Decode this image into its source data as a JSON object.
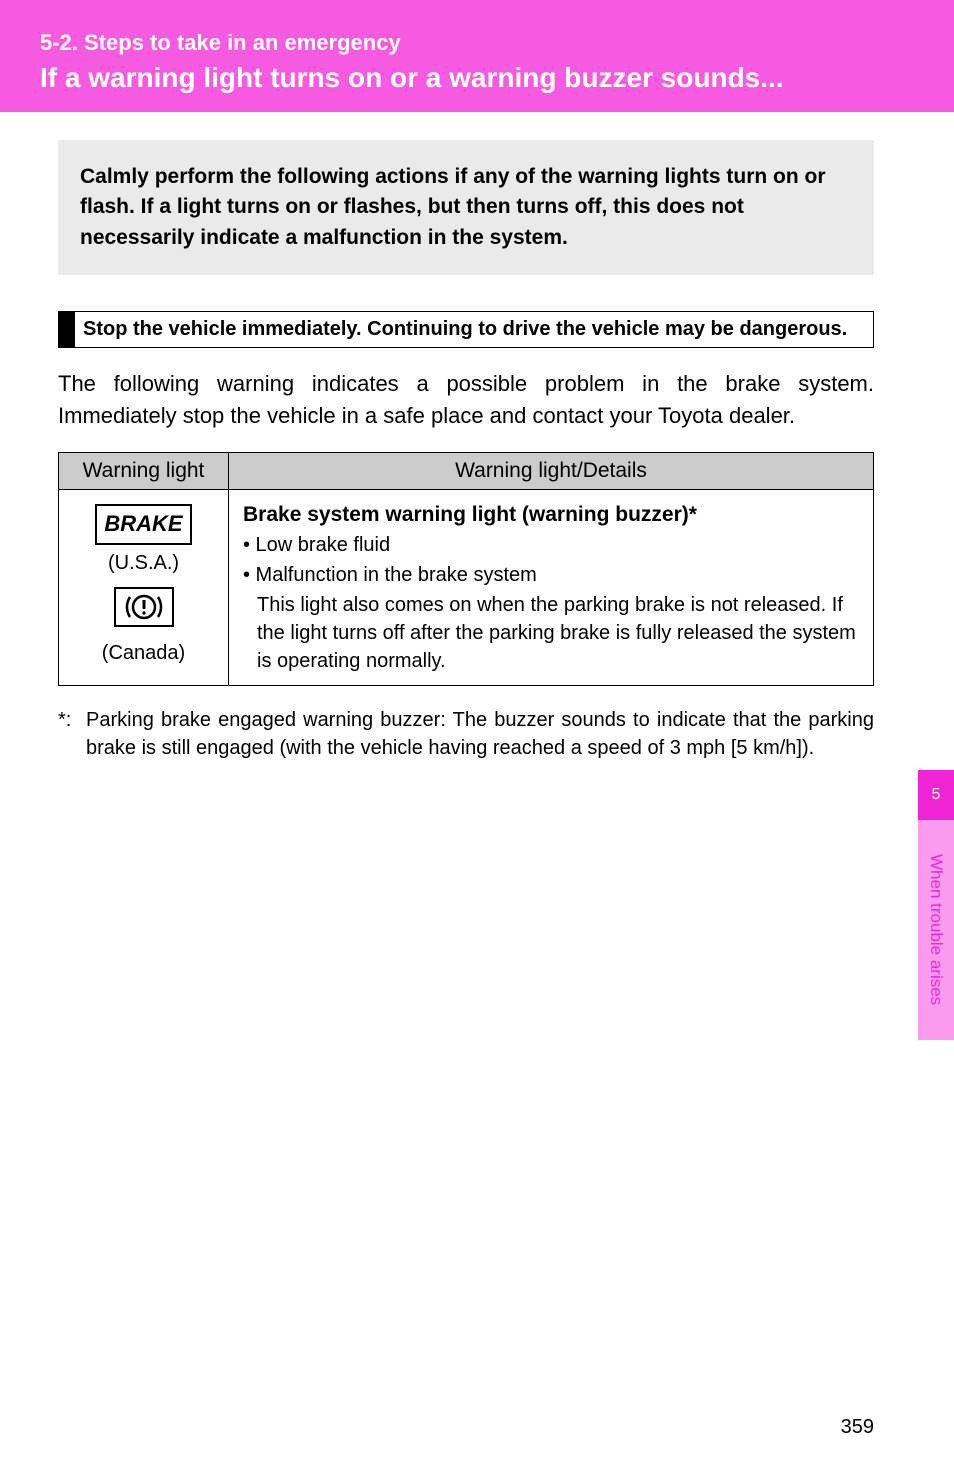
{
  "header": {
    "section_number": "5-2. Steps to take in an emergency",
    "title": "If a warning light turns on or a warning buzzer sounds..."
  },
  "intro": "Calmly perform the following actions if any of the warning lights turn on or flash. If a light turns on or flashes, but then turns off, this does not necessarily indicate a malfunction in the system.",
  "subhead": "Stop the vehicle immediately. Continuing to drive the vehicle may be dangerous.",
  "body": "The following warning indicates a possible problem in the brake system. Immediately stop the vehicle in a safe place and contact your Toyota dealer.",
  "table": {
    "col1_header": "Warning light",
    "col2_header": "Warning light/Details",
    "row1": {
      "icon_brake": "BRAKE",
      "label_usa": "(U.S.A.)",
      "label_canada": "(Canada)",
      "details_title": "Brake system warning light (warning buzzer)*",
      "bullet1": "• Low brake fluid",
      "bullet2": "• Malfunction in the brake system",
      "indent_text": "This light also comes on when the parking brake is not released. If the light turns off after the parking brake is fully released the system is operating normally."
    }
  },
  "footnote": {
    "marker": "*:",
    "text": "Parking brake engaged warning buzzer: The buzzer sounds to indicate that the parking brake is still engaged (with the vehicle having reached a speed of 3 mph [5 km/h])."
  },
  "side": {
    "chapter": "5",
    "label": "When trouble arises"
  },
  "page_number": "359"
}
